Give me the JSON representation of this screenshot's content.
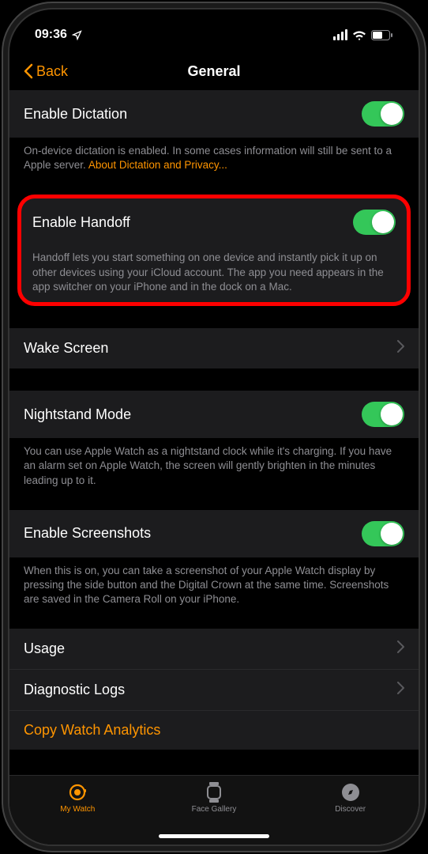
{
  "status": {
    "time": "09:36"
  },
  "nav": {
    "back_label": "Back",
    "title": "General"
  },
  "sections": {
    "dictation": {
      "label": "Enable Dictation",
      "toggle": true,
      "footer": "On-device dictation is enabled. In some cases information will still be sent to a Apple server. ",
      "link": "About Dictation and Privacy..."
    },
    "handoff": {
      "label": "Enable Handoff",
      "toggle": true,
      "footer": "Handoff lets you start something on one device and instantly pick it up on other devices using your iCloud account. The app you need appears in the app switcher on your iPhone and in the dock on a Mac."
    },
    "wake": {
      "label": "Wake Screen"
    },
    "nightstand": {
      "label": "Nightstand Mode",
      "toggle": true,
      "footer": "You can use Apple Watch as a nightstand clock while it's charging. If you have an alarm set on Apple Watch, the screen will gently brighten in the minutes leading up to it."
    },
    "screenshots": {
      "label": "Enable Screenshots",
      "toggle": true,
      "footer": "When this is on, you can take a screenshot of your Apple Watch display by pressing the side button and the Digital Crown at the same time. Screenshots are saved in the Camera Roll on your iPhone."
    },
    "usage": {
      "label": "Usage"
    },
    "diagnostic": {
      "label": "Diagnostic Logs"
    },
    "analytics": {
      "label": "Copy Watch Analytics"
    }
  },
  "tabs": {
    "mywatch": "My Watch",
    "facegallery": "Face Gallery",
    "discover": "Discover"
  }
}
